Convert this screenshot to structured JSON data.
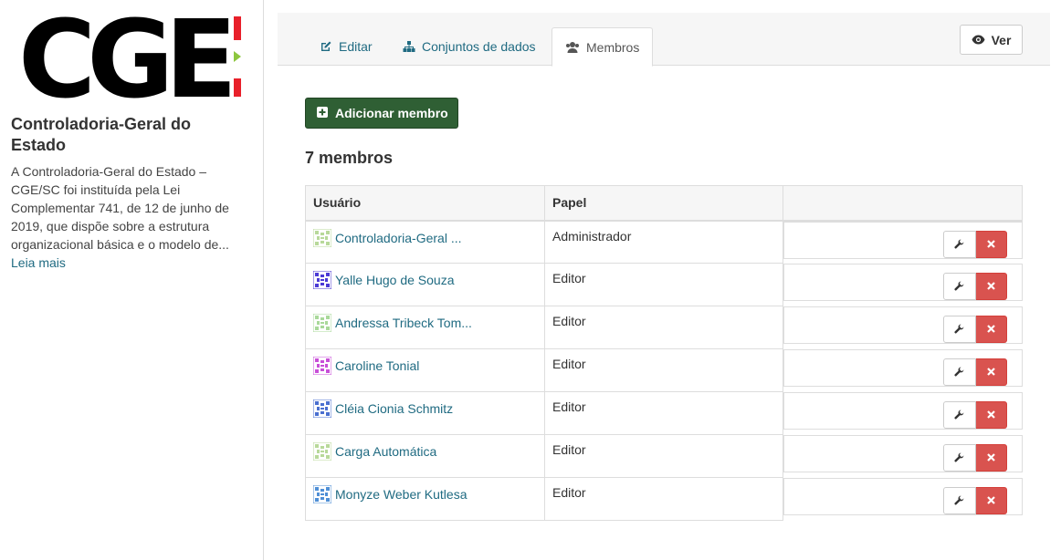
{
  "org": {
    "logo_text": "CGE",
    "title": "Controladoria-Geral do Estado",
    "description": "A Controladoria-Geral do Estado – CGE/SC foi instituída pela Lei Complementar 741, de 12 de junho de 2019, que dispõe sobre a estrutura organizacional básica e o modelo de...",
    "read_more": "Leia mais"
  },
  "tabs": [
    {
      "label": "Editar",
      "icon": "edit-icon"
    },
    {
      "label": "Conjuntos de dados",
      "icon": "sitemap-icon"
    },
    {
      "label": "Membros",
      "icon": "users-icon",
      "active": true
    }
  ],
  "view_button": "Ver",
  "add_member_button": "Adicionar membro",
  "member_count": "7 membros",
  "table": {
    "headers": [
      "Usuário",
      "Papel",
      ""
    ],
    "rows": [
      {
        "user": "Controladoria-Geral ...",
        "role": "Administrador",
        "avatar_color": "#b8d99a"
      },
      {
        "user": "Yalle Hugo de Souza",
        "role": "Editor",
        "avatar_color": "#4b3ad6"
      },
      {
        "user": "Andressa Tribeck Tom...",
        "role": "Editor",
        "avatar_color": "#a9d99a"
      },
      {
        "user": "Caroline Tonial",
        "role": "Editor",
        "avatar_color": "#c84fd8"
      },
      {
        "user": "Cléia Cionia Schmitz",
        "role": "Editor",
        "avatar_color": "#4a6fd0"
      },
      {
        "user": "Carga Automática",
        "role": "Editor",
        "avatar_color": "#b8d99a"
      },
      {
        "user": "Monyze Weber Kutlesa",
        "role": "Editor",
        "avatar_color": "#4f8fd6"
      }
    ]
  },
  "colors": {
    "link": "#206b82",
    "add_button": "#2f5f34",
    "delete_button": "#d9534f",
    "logo_red": "#e8202a",
    "logo_green": "#8dc63f"
  }
}
